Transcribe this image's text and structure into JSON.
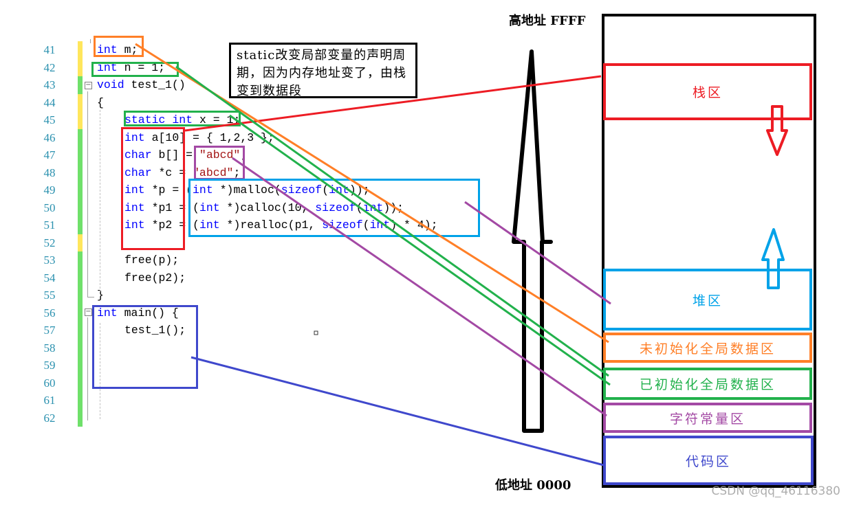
{
  "editor": {
    "lines": [
      {
        "num": "41",
        "bar": "yellow",
        "tokens": [
          {
            "t": "int",
            "c": "kw"
          },
          {
            "t": " m;",
            "c": ""
          }
        ],
        "indent": 0
      },
      {
        "num": "42",
        "bar": "yellow",
        "tokens": [
          {
            "t": "int",
            "c": "kw"
          },
          {
            "t": " n = 1;",
            "c": ""
          }
        ],
        "indent": 0
      },
      {
        "num": "43",
        "bar": "green",
        "tokens": [
          {
            "t": "void",
            "c": "kw"
          },
          {
            "t": " test_1()",
            "c": ""
          }
        ],
        "indent": 0
      },
      {
        "num": "44",
        "bar": "yellow",
        "tokens": [
          {
            "t": "{",
            "c": ""
          }
        ],
        "indent": 0
      },
      {
        "num": "45",
        "bar": "yellow",
        "tokens": [
          {
            "t": "static",
            "c": "kw"
          },
          {
            "t": " ",
            "c": ""
          },
          {
            "t": "int",
            "c": "kw"
          },
          {
            "t": " x = 1;",
            "c": ""
          }
        ],
        "indent": 1
      },
      {
        "num": "46",
        "bar": "green",
        "tokens": [
          {
            "t": "int",
            "c": "kw"
          },
          {
            "t": " a[10] = { 1,2,3 };",
            "c": ""
          }
        ],
        "indent": 1
      },
      {
        "num": "47",
        "bar": "green",
        "tokens": [
          {
            "t": "char",
            "c": "kw"
          },
          {
            "t": " b[] = ",
            "c": ""
          },
          {
            "t": "\"abcd\"",
            "c": "str"
          },
          {
            "t": ";",
            "c": ""
          }
        ],
        "indent": 1
      },
      {
        "num": "48",
        "bar": "green",
        "tokens": [
          {
            "t": "char",
            "c": "kw"
          },
          {
            "t": " *c = ",
            "c": ""
          },
          {
            "t": "\"abcd\"",
            "c": "str"
          },
          {
            "t": ";",
            "c": ""
          }
        ],
        "indent": 1
      },
      {
        "num": "49",
        "bar": "green",
        "tokens": [
          {
            "t": "int",
            "c": "kw"
          },
          {
            "t": " *p = (",
            "c": ""
          },
          {
            "t": "int",
            "c": "kw"
          },
          {
            "t": " *)malloc(",
            "c": ""
          },
          {
            "t": "sizeof",
            "c": "kw"
          },
          {
            "t": "(",
            "c": ""
          },
          {
            "t": "int",
            "c": "kw"
          },
          {
            "t": "));",
            "c": ""
          }
        ],
        "indent": 1
      },
      {
        "num": "50",
        "bar": "green",
        "tokens": [
          {
            "t": "int",
            "c": "kw"
          },
          {
            "t": " *p1 = (",
            "c": ""
          },
          {
            "t": "int",
            "c": "kw"
          },
          {
            "t": " *)calloc(10, ",
            "c": ""
          },
          {
            "t": "sizeof",
            "c": "kw"
          },
          {
            "t": "(",
            "c": ""
          },
          {
            "t": "int",
            "c": "kw"
          },
          {
            "t": "));",
            "c": ""
          }
        ],
        "indent": 1
      },
      {
        "num": "51",
        "bar": "green",
        "tokens": [
          {
            "t": "int",
            "c": "kw"
          },
          {
            "t": " *p2 = (",
            "c": ""
          },
          {
            "t": "int",
            "c": "kw"
          },
          {
            "t": " *)realloc(p1, ",
            "c": ""
          },
          {
            "t": "sizeof",
            "c": "kw"
          },
          {
            "t": "(",
            "c": ""
          },
          {
            "t": "int",
            "c": "kw"
          },
          {
            "t": ") * 4);",
            "c": ""
          }
        ],
        "indent": 1
      },
      {
        "num": "52",
        "bar": "yellow",
        "tokens": [],
        "indent": 1
      },
      {
        "num": "53",
        "bar": "green",
        "tokens": [
          {
            "t": "free(p);",
            "c": ""
          }
        ],
        "indent": 1
      },
      {
        "num": "54",
        "bar": "green",
        "tokens": [
          {
            "t": "free(p2);",
            "c": ""
          }
        ],
        "indent": 1
      },
      {
        "num": "55",
        "bar": "green",
        "tokens": [
          {
            "t": "}",
            "c": ""
          }
        ],
        "indent": 0
      },
      {
        "num": "56",
        "bar": "green",
        "tokens": [
          {
            "t": "int",
            "c": "kw"
          },
          {
            "t": " main() {",
            "c": ""
          }
        ],
        "indent": 0
      },
      {
        "num": "57",
        "bar": "green",
        "tokens": [
          {
            "t": "test_1();",
            "c": ""
          }
        ],
        "indent": 1
      },
      {
        "num": "58",
        "bar": "green",
        "tokens": [],
        "indent": 1
      },
      {
        "num": "59",
        "bar": "green",
        "tokens": [],
        "indent": 1
      },
      {
        "num": "60",
        "bar": "green",
        "tokens": [],
        "indent": 1
      },
      {
        "num": "61",
        "bar": "green",
        "tokens": [],
        "indent": 1
      },
      {
        "num": "62",
        "bar": "green",
        "tokens": [],
        "indent": 1
      }
    ],
    "bar_colors": {
      "yellow": "#ffe65c",
      "green": "#6fe06a"
    }
  },
  "note": {
    "text": "static改变局部变量的声明周期，因为内存地址变了，由栈变到数据段"
  },
  "memory": {
    "high_label": "高地址  FFFF",
    "low_label": "低地址   0000",
    "segments": {
      "stack": {
        "label": "栈区",
        "color": "#ed1c24"
      },
      "heap": {
        "label": "堆区",
        "color": "#00a2e8"
      },
      "bss": {
        "label": "未初始化全局数据区",
        "color": "#ff7f27"
      },
      "data": {
        "label": "已初始化全局数据区",
        "color": "#22b14c"
      },
      "rodata": {
        "label": "字符常量区",
        "color": "#a349a4"
      },
      "text": {
        "label": "代码区",
        "color": "#3f48cc"
      }
    }
  },
  "watermark": "CSDN @qq_46116380"
}
